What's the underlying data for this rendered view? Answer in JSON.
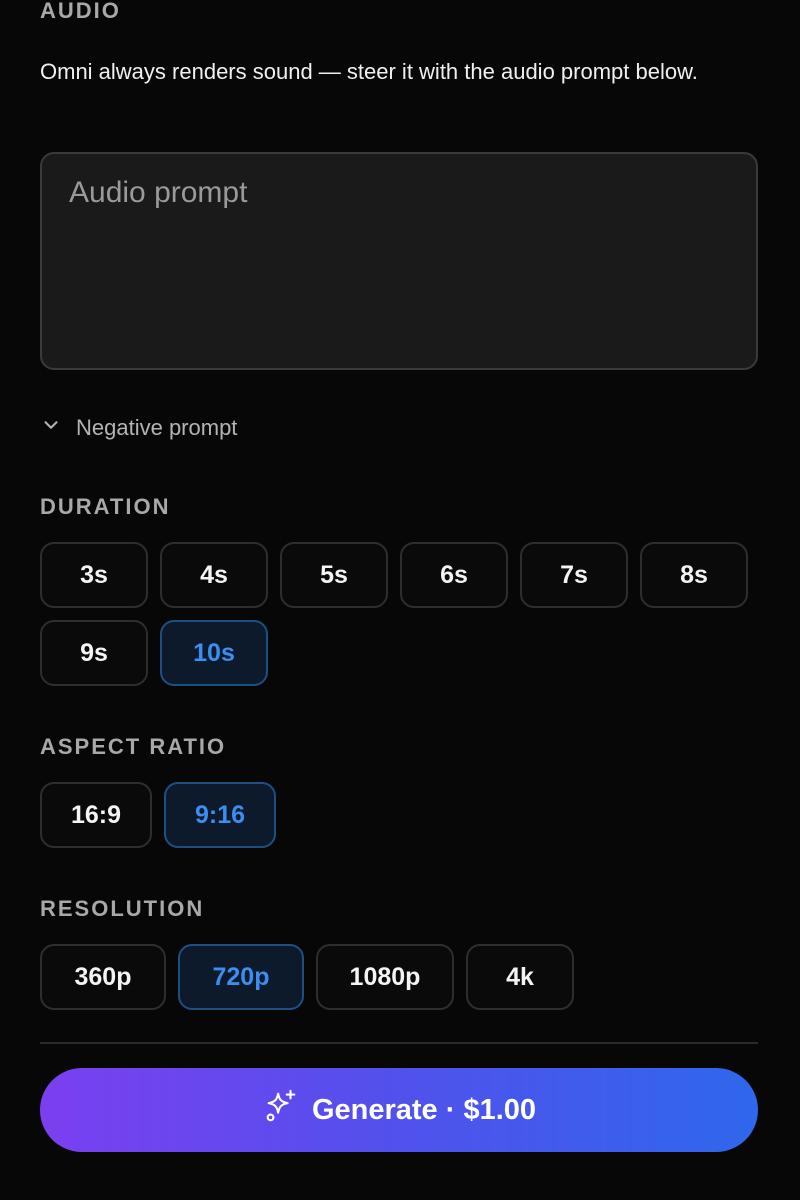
{
  "audio": {
    "label": "AUDIO",
    "description": "Omni always renders sound — steer it with the audio prompt below.",
    "prompt_placeholder": "Audio prompt",
    "prompt_value": ""
  },
  "negative_prompt": {
    "label": "Negative prompt",
    "icon": "chevron-down-icon",
    "expanded": false
  },
  "duration": {
    "label": "DURATION",
    "options": [
      "3s",
      "4s",
      "5s",
      "6s",
      "7s",
      "8s",
      "9s",
      "10s"
    ],
    "selected": "10s"
  },
  "aspect_ratio": {
    "label": "ASPECT RATIO",
    "options": [
      "16:9",
      "9:16"
    ],
    "selected": "9:16"
  },
  "resolution": {
    "label": "RESOLUTION",
    "options": [
      "360p",
      "720p",
      "1080p",
      "4k"
    ],
    "selected": "720p"
  },
  "generate": {
    "label": "Generate · $1.00",
    "icon": "sparkles-icon"
  },
  "colors": {
    "background": "#070707",
    "selected_text": "#3b8ef0",
    "selected_border": "#1d4f85",
    "gradient_start": "#7b3ff0",
    "gradient_end": "#2f67ec"
  }
}
